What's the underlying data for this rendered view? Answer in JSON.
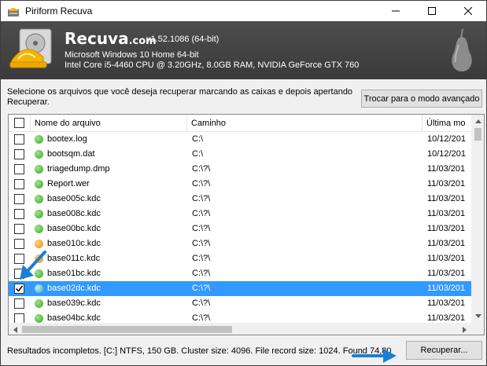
{
  "window": {
    "title": "Piriform Recuva"
  },
  "header": {
    "brand_name": "Recuva",
    "brand_suffix": ".com",
    "version": "v1.52.1086 (64-bit)",
    "os_line": "Microsoft Windows 10 Home 64-bit",
    "hw_line": "Intel Core i5-4460 CPU @ 3.20GHz, 8.0GB RAM, NVIDIA GeForce GTX 760"
  },
  "instruction": "Selecione os arquivos que você deseja recuperar marcando as caixas e depois apertando Recuperar.",
  "advanced_button": "Trocar para o modo avançado",
  "columns": {
    "name": "Nome do arquivo",
    "path": "Caminho",
    "date": "Última mo"
  },
  "files": [
    {
      "name": "bootex.log",
      "path": "C:\\",
      "date": "10/12/201",
      "state": "green",
      "checked": false,
      "selected": false
    },
    {
      "name": "bootsqm.dat",
      "path": "C:\\",
      "date": "10/12/201",
      "state": "green",
      "checked": false,
      "selected": false
    },
    {
      "name": "triagedump.dmp",
      "path": "C:\\?\\",
      "date": "11/03/201",
      "state": "green",
      "checked": false,
      "selected": false
    },
    {
      "name": "Report.wer",
      "path": "C:\\?\\",
      "date": "11/03/201",
      "state": "green",
      "checked": false,
      "selected": false
    },
    {
      "name": "base005c.kdc",
      "path": "C:\\?\\",
      "date": "11/03/201",
      "state": "green",
      "checked": false,
      "selected": false
    },
    {
      "name": "base008c.kdc",
      "path": "C:\\?\\",
      "date": "11/03/201",
      "state": "green",
      "checked": false,
      "selected": false
    },
    {
      "name": "base00bc.kdc",
      "path": "C:\\?\\",
      "date": "11/03/201",
      "state": "green",
      "checked": false,
      "selected": false
    },
    {
      "name": "base010c.kdc",
      "path": "C:\\?\\",
      "date": "11/03/201",
      "state": "orange",
      "checked": false,
      "selected": false
    },
    {
      "name": "base011c.kdc",
      "path": "C:\\?\\",
      "date": "11/03/201",
      "state": "orange",
      "checked": false,
      "selected": false
    },
    {
      "name": "base01bc.kdc",
      "path": "C:\\?\\",
      "date": "11/03/201",
      "state": "green",
      "checked": false,
      "selected": false
    },
    {
      "name": "base02dc.kdc",
      "path": "C:\\?\\",
      "date": "11/03/201",
      "state": "teal",
      "checked": true,
      "selected": true
    },
    {
      "name": "base039c.kdc",
      "path": "C:\\?\\",
      "date": "11/03/201",
      "state": "green",
      "checked": false,
      "selected": false
    },
    {
      "name": "base04bc.kdc",
      "path": "C:\\?\\",
      "date": "11/03/201",
      "state": "green",
      "checked": false,
      "selected": false
    }
  ],
  "status_text": "Resultados incompletos. [C:] NTFS, 150 GB. Cluster size: 4096. File record size: 1024. Found 74,80",
  "recover_button": "Recuperar...",
  "colors": {
    "selection": "#3399ff",
    "annotation_arrow": "#1a7fd4",
    "header_bg": "#444444"
  }
}
